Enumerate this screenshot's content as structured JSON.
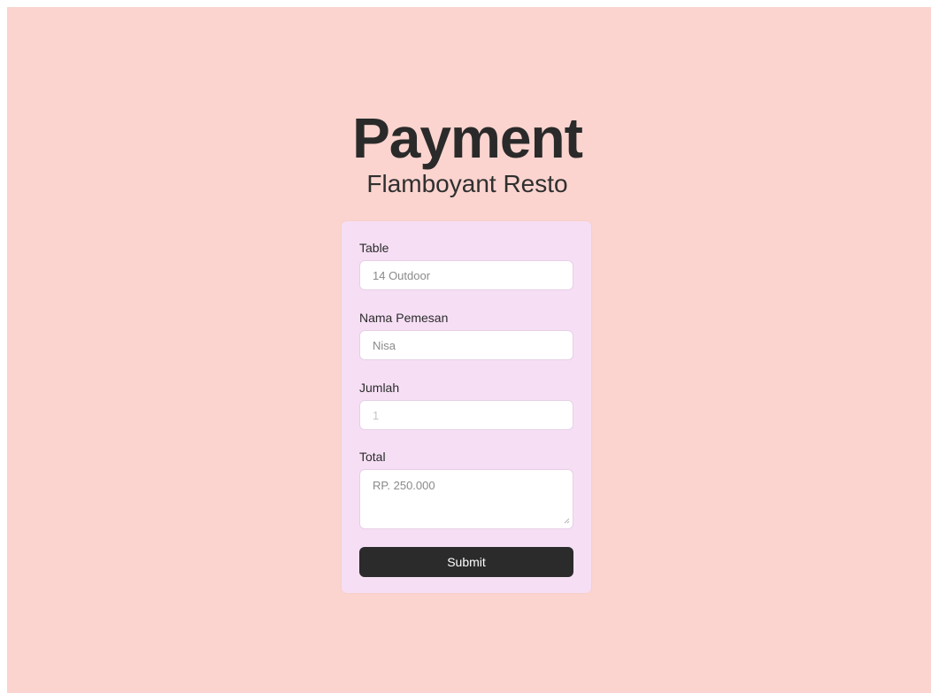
{
  "header": {
    "title": "Payment",
    "subtitle": "Flamboyant Resto"
  },
  "form": {
    "table": {
      "label": "Table",
      "value": "14 Outdoor"
    },
    "nama_pemesan": {
      "label": "Nama Pemesan",
      "value": "Nisa"
    },
    "jumlah": {
      "label": "Jumlah",
      "placeholder": "1"
    },
    "total": {
      "label": "Total",
      "value": "RP. 250.000"
    },
    "submit_label": "Submit"
  },
  "colors": {
    "background": "#fbd4cf",
    "card": "#f6dff5",
    "button": "#2b2b2b",
    "text": "#2a2a2a"
  }
}
